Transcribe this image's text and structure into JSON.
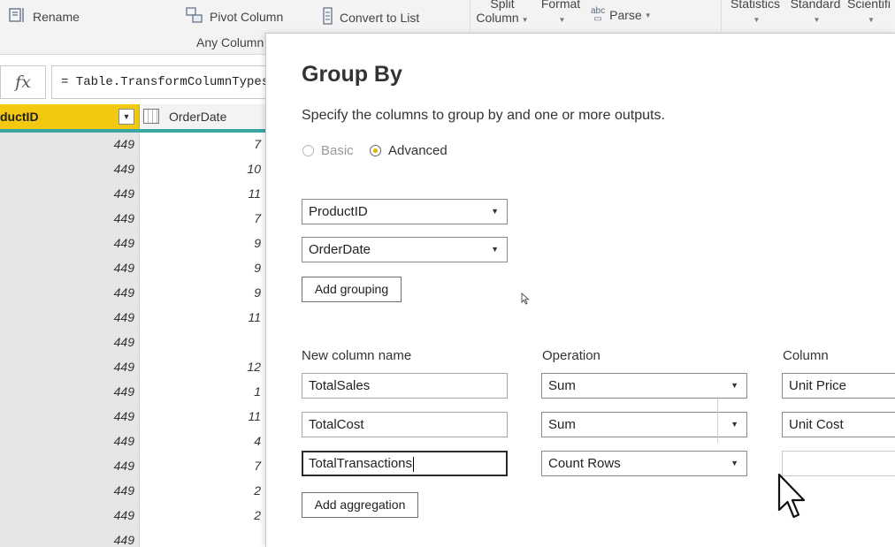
{
  "ribbon": {
    "rename": "Rename",
    "pivot_column": "Pivot Column",
    "convert_to_list": "Convert to List",
    "any_column": "Any Column",
    "split_column_line1": "Split",
    "split_column_line2": "Column",
    "format": "Format",
    "parse": "Parse",
    "statistics": "Statistics",
    "standard": "Standard",
    "scientific": "Scientifi"
  },
  "formula_bar": {
    "fx": "fx",
    "formula": "= Table.TransformColumnTypes("
  },
  "grid": {
    "columns": [
      {
        "label": "ductID"
      },
      {
        "label": "OrderDate"
      }
    ],
    "rows": [
      {
        "product_id": "449",
        "order_date": "7"
      },
      {
        "product_id": "449",
        "order_date": "10"
      },
      {
        "product_id": "449",
        "order_date": "11"
      },
      {
        "product_id": "449",
        "order_date": "7"
      },
      {
        "product_id": "449",
        "order_date": "9"
      },
      {
        "product_id": "449",
        "order_date": "9"
      },
      {
        "product_id": "449",
        "order_date": "9"
      },
      {
        "product_id": "449",
        "order_date": "11"
      },
      {
        "product_id": "449",
        "order_date": ""
      },
      {
        "product_id": "449",
        "order_date": "12"
      },
      {
        "product_id": "449",
        "order_date": "1"
      },
      {
        "product_id": "449",
        "order_date": "11"
      },
      {
        "product_id": "449",
        "order_date": "4"
      },
      {
        "product_id": "449",
        "order_date": "7"
      },
      {
        "product_id": "449",
        "order_date": "2"
      },
      {
        "product_id": "449",
        "order_date": "2"
      },
      {
        "product_id": "449",
        "order_date": ""
      }
    ]
  },
  "dialog": {
    "title": "Group By",
    "subtitle": "Specify the columns to group by and one or more outputs.",
    "radio_basic": "Basic",
    "radio_advanced": "Advanced",
    "selected_mode": "Advanced",
    "groupings": [
      "ProductID",
      "OrderDate"
    ],
    "add_grouping": "Add grouping",
    "labels": {
      "new_column_name": "New column name",
      "operation": "Operation",
      "column": "Column"
    },
    "aggregations": [
      {
        "name": "TotalSales",
        "operation": "Sum",
        "column": "Unit Price"
      },
      {
        "name": "TotalCost",
        "operation": "Sum",
        "column": "Unit Cost"
      },
      {
        "name": "TotalTransactions",
        "operation": "Count Rows",
        "column": ""
      }
    ],
    "add_aggregation": "Add aggregation"
  },
  "colors": {
    "ribbon_bg": "#f3f3f3",
    "selected_header": "#f2c811",
    "teal_quality_bar": "#39a6a1",
    "radio_dot": "#e0b400"
  }
}
